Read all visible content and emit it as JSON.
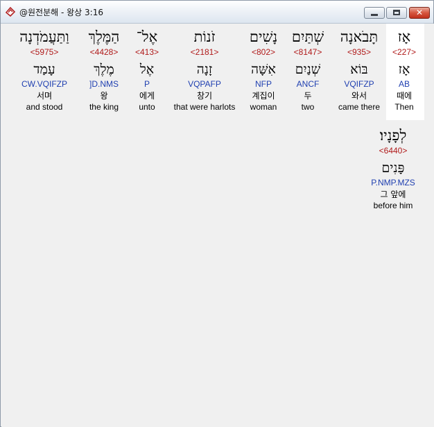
{
  "window": {
    "title": "@원전분해 - 왕상 3:16",
    "controls": {
      "minimize_icon": "minimize-icon",
      "maximize_icon": "maximize-icon",
      "close_glyph": "✕"
    }
  },
  "colors": {
    "strong": "#b01a1a",
    "morph": "#1f3fb0",
    "highlight": "#ffffff"
  },
  "words": [
    {
      "hebrew": "אָז",
      "strong": "<227>",
      "lemma": "אָז",
      "morph": "AB",
      "korean": "때에",
      "english": "Then",
      "highlighted": true
    },
    {
      "hebrew": "תָּבֹאנָה",
      "strong": "<935>",
      "lemma": "בּוֹא",
      "morph": "VQIFZP",
      "korean": "와서",
      "english": "came there"
    },
    {
      "hebrew": "שְׁתַּיִם",
      "strong": "<8147>",
      "lemma": "שְׁנַיִם",
      "morph": "ANCF",
      "korean": "두",
      "english": "two"
    },
    {
      "hebrew": "נָשִׁים",
      "strong": "<802>",
      "lemma": "אִשָּׁה",
      "morph": "NFP",
      "korean": "계집이",
      "english": "woman"
    },
    {
      "hebrew": "זֹנוֹת",
      "strong": "<2181>",
      "lemma": "זָנָה",
      "morph": "VQPAFP",
      "korean": "창기",
      "english": "that were harlots"
    },
    {
      "hebrew": "אֶל־",
      "strong": "<413>",
      "lemma": "אֶל",
      "morph": "P",
      "korean": "에게",
      "english": "unto"
    },
    {
      "hebrew": "הַמֶּלֶךְ",
      "strong": "<4428>",
      "lemma": "מֶלֶךְ",
      "morph": "]D.NMS",
      "korean": "왕",
      "english": "the king"
    },
    {
      "hebrew": "וַתַּעֲמֹדְנָה",
      "strong": "<5975>",
      "lemma": "עָמַד",
      "morph": "CW.VQIFZP",
      "korean": "서며",
      "english": "and stood"
    },
    {
      "hebrew": "לְפָנָיו׃",
      "strong": "<6440>",
      "lemma": "פָּנִים",
      "morph": "P.NMP.MZS",
      "korean": "그 앞에",
      "english": "before him"
    }
  ]
}
